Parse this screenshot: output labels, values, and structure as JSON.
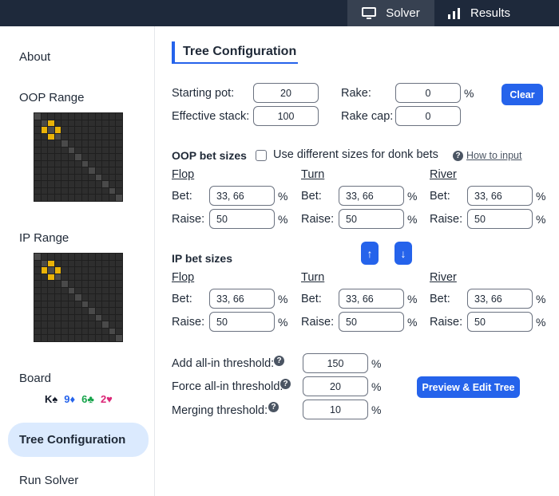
{
  "topbar": {
    "tabs": [
      {
        "label": "Solver",
        "icon": "monitor-icon"
      },
      {
        "label": "Results",
        "icon": "bar-chart-icon"
      }
    ]
  },
  "sidebar": {
    "about": "About",
    "oop_range": "OOP Range",
    "ip_range": "IP Range",
    "board": "Board",
    "board_cards": [
      {
        "text": "K♠",
        "color": "#111827"
      },
      {
        "text": "9♦",
        "color": "#2563eb"
      },
      {
        "text": "6♣",
        "color": "#16a34a"
      },
      {
        "text": "2♥",
        "color": "#db2777"
      }
    ],
    "tree_configuration": "Tree Configuration",
    "run_solver": "Run Solver"
  },
  "main": {
    "title": "Tree Configuration",
    "starting_pot_label": "Starting pot:",
    "starting_pot": "20",
    "effective_stack_label": "Effective stack:",
    "effective_stack": "100",
    "rake_label": "Rake:",
    "rake": "0",
    "rake_cap_label": "Rake cap:",
    "rake_cap": "0",
    "percent": "%",
    "clear_button": "Clear",
    "oop_bet_sizes": "OOP bet sizes",
    "donk_checkbox_label": "Use different sizes for donk bets",
    "how_to_input": "How to input",
    "ip_bet_sizes": "IP bet sizes",
    "streets": [
      "Flop",
      "Turn",
      "River"
    ],
    "bet_label": "Bet:",
    "raise_label": "Raise:",
    "oop": {
      "flop": {
        "bet": "33, 66",
        "raise": "50"
      },
      "turn": {
        "bet": "33, 66",
        "raise": "50"
      },
      "river": {
        "bet": "33, 66",
        "raise": "50"
      }
    },
    "ip": {
      "flop": {
        "bet": "33, 66",
        "raise": "50"
      },
      "turn": {
        "bet": "33, 66",
        "raise": "50"
      },
      "river": {
        "bet": "33, 66",
        "raise": "50"
      }
    },
    "arrow_up": "↑",
    "arrow_down": "↓",
    "add_allin_label": "Add all-in threshold:",
    "add_allin": "150",
    "force_allin_label": "Force all-in threshold:",
    "force_allin": "20",
    "merging_label": "Merging threshold:",
    "merging": "10",
    "preview_button": "Preview & Edit Tree"
  }
}
